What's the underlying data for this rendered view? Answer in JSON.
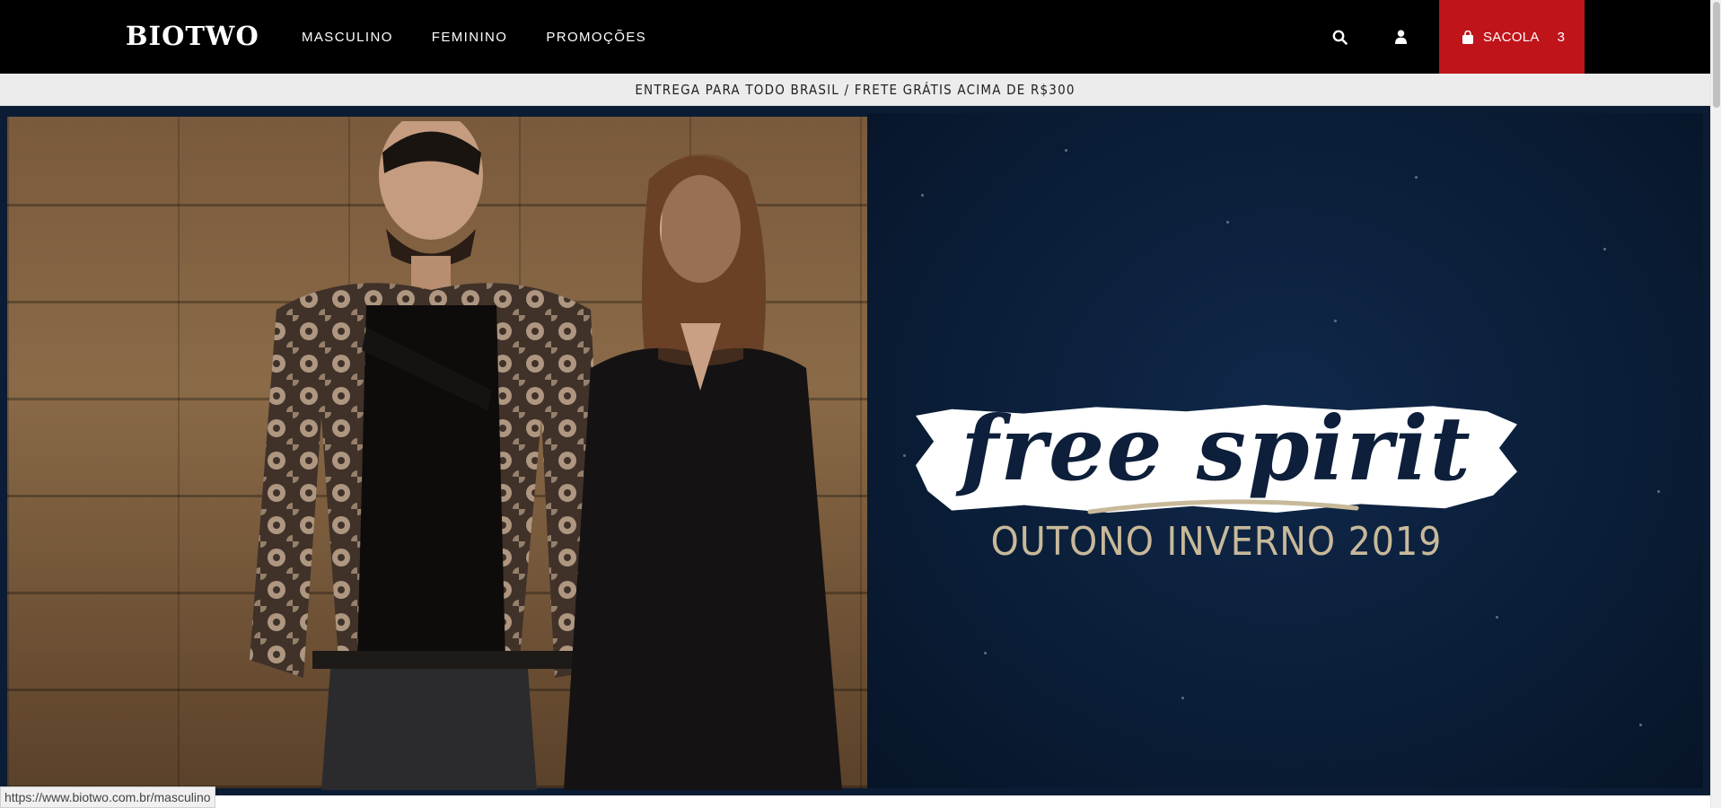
{
  "header": {
    "logo": "BIOTWO",
    "nav": [
      {
        "label": "MASCULINO"
      },
      {
        "label": "FEMININO"
      },
      {
        "label": "PROMOÇÕES"
      }
    ],
    "search_icon": "search-icon",
    "account_icon": "user-icon",
    "cart": {
      "icon": "shopping-bag-icon",
      "label": "SACOLA",
      "count": "3"
    }
  },
  "announcement": {
    "text": "ENTREGA PARA TODO BRASIL / FRETE GRÁTIS ACIMA DE R$300"
  },
  "hero": {
    "title": "free spirit",
    "subtitle": "OUTONO INVERNO 2019"
  },
  "statusbar": {
    "url": "https://www.biotwo.com.br/masculino"
  },
  "colors": {
    "header_bg": "#000000",
    "cart_bg": "#c0141b",
    "announcement_bg": "#ececec",
    "hero_navy": "#0b1c34",
    "hero_title": "#0d1f3a",
    "hero_subtitle": "#c8b99a"
  }
}
